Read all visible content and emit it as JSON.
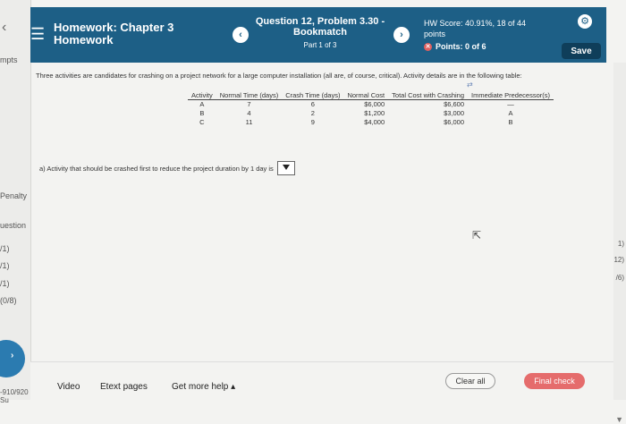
{
  "header": {
    "title_line1": "Homework: Chapter 3",
    "title_line2": "Homework",
    "question_title": "Question 12, Problem 3.30 -",
    "question_subtitle": "Bookmatch",
    "question_part": "Part 1 of 3",
    "score_label": "HW Score: 40.91%, 18 of 44",
    "score_label2": "points",
    "points_label": "Points: 0 of 6",
    "save_label": "Save"
  },
  "leftpanel": {
    "labels": [
      "mpts",
      "Penalty",
      "uestion",
      "/1)",
      "/1)",
      "/1)",
      "(0/8)"
    ],
    "bottom": "-910/920 Su"
  },
  "rightpanel": {
    "labels": [
      "1)",
      "12)",
      "/6)"
    ]
  },
  "content": {
    "intro": "Three activities are candidates for crashing on a project network for a large computer installation (all are, of course, critical). Activity details are in the following table:",
    "table": {
      "headers": [
        "Activity",
        "Normal Time (days)",
        "Crash Time (days)",
        "Normal Cost",
        "Total Cost with Crashing",
        "Immediate Predecessor(s)"
      ],
      "rows": [
        [
          "A",
          "7",
          "6",
          "$6,000",
          "$6,600",
          "—"
        ],
        [
          "B",
          "4",
          "2",
          "$1,200",
          "$3,000",
          "A"
        ],
        [
          "C",
          "11",
          "9",
          "$4,000",
          "$6,000",
          "B"
        ]
      ]
    },
    "question": "a) Activity that should be crashed first to reduce the project duration by 1 day is"
  },
  "footer": {
    "video": "Video",
    "etext": "Etext pages",
    "help": "Get more help ▴",
    "clear": "Clear all",
    "final": "Final check"
  }
}
